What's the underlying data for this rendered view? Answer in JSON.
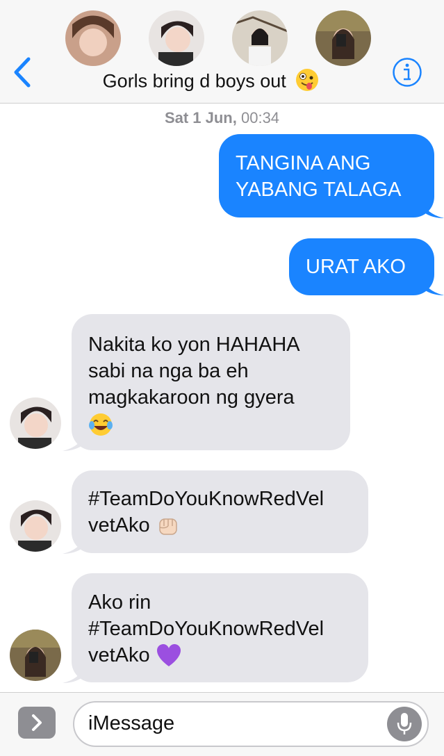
{
  "header": {
    "group_name": "Gorls bring d boys out",
    "group_emoji": "zany-face-emoji",
    "avatars": [
      "member-avatar-1",
      "member-avatar-2",
      "member-avatar-3",
      "member-avatar-4"
    ]
  },
  "conversation": {
    "timestamp_day": "Sat 1 Jun,",
    "timestamp_time": "00:34",
    "messages": [
      {
        "direction": "sent",
        "lines": [
          "TANGINA ANG",
          "YABANG TALAGA"
        ]
      },
      {
        "direction": "sent",
        "lines": [
          "URAT AKO"
        ]
      },
      {
        "direction": "received",
        "lines": [
          "Nakita ko yon HAHAHA",
          "sabi na nga ba eh",
          "magkakaroon ng gyera"
        ],
        "emoji": "tears-of-joy-emoji"
      },
      {
        "direction": "received",
        "lines": [
          "#TeamDoYouKnowRedVel",
          "vetAko"
        ],
        "emoji": "raised-fist-emoji"
      },
      {
        "direction": "received",
        "lines": [
          "Ako rin",
          "#TeamDoYouKnowRedVel",
          "vetAko"
        ],
        "emoji": "purple-heart-emoji"
      }
    ]
  },
  "input": {
    "placeholder": "iMessage"
  },
  "colors": {
    "sent_bubble": "#1a84ff",
    "received_bubble": "#e5e5ea",
    "accent": "#1a84ff"
  }
}
